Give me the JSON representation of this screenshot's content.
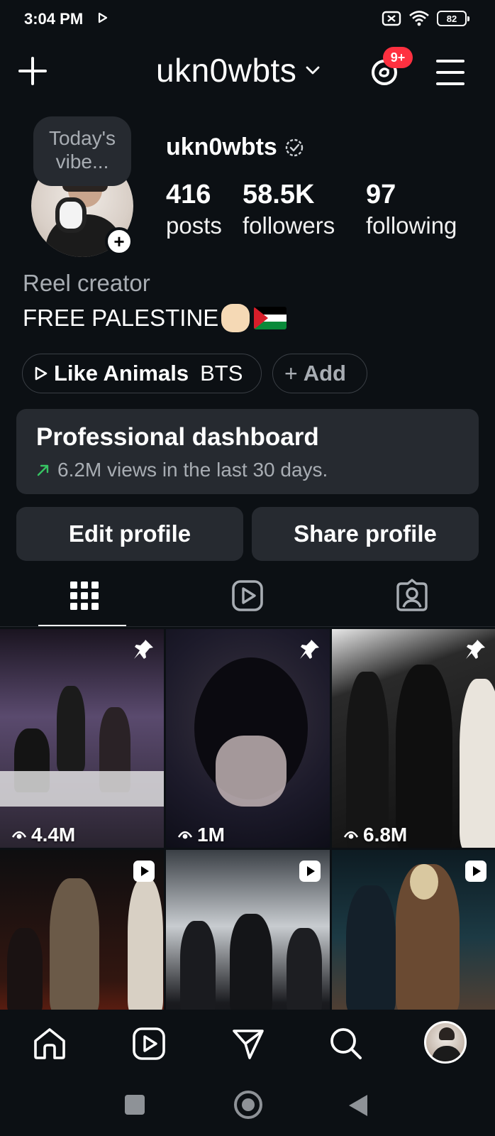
{
  "status_bar": {
    "time": "3:04 PM",
    "battery": "82"
  },
  "header": {
    "username": "ukn0wbts",
    "notification_badge": "9+"
  },
  "profile": {
    "note": "Today's vibe...",
    "username": "ukn0wbts",
    "stats": [
      {
        "value": "416",
        "label": "posts"
      },
      {
        "value": "58.5K",
        "label": "followers"
      },
      {
        "value": "97",
        "label": "following"
      }
    ],
    "category": "Reel creator",
    "bio": "FREE PALESTINE"
  },
  "highlights": {
    "item_bold": "Like Animals",
    "item_rest": "BTS",
    "add_label": "Add"
  },
  "dashboard": {
    "title": "Professional dashboard",
    "subtitle": "6.2M views in the last 30 days."
  },
  "actions": {
    "edit": "Edit profile",
    "share": "Share profile"
  },
  "grid": {
    "items": [
      {
        "views": "4.4M",
        "type": "pinned"
      },
      {
        "views": "1M",
        "type": "pinned"
      },
      {
        "views": "6.8M",
        "type": "pinned"
      },
      {
        "views": "",
        "type": "reel"
      },
      {
        "views": "",
        "type": "reel"
      },
      {
        "views": "",
        "type": "reel"
      }
    ]
  },
  "colors": {
    "background": "#0c1014",
    "surface": "#262a30",
    "badge": "#ff3040",
    "trend": "#37c463"
  },
  "icons": {
    "header": [
      "plus-icon",
      "chevron-down-icon",
      "threads-icon",
      "menu-icon"
    ],
    "tabs": [
      "grid-icon",
      "reels-icon",
      "tagged-icon"
    ],
    "bottom_nav": [
      "home-icon",
      "reels-icon",
      "send-icon",
      "search-icon",
      "profile-avatar"
    ]
  }
}
